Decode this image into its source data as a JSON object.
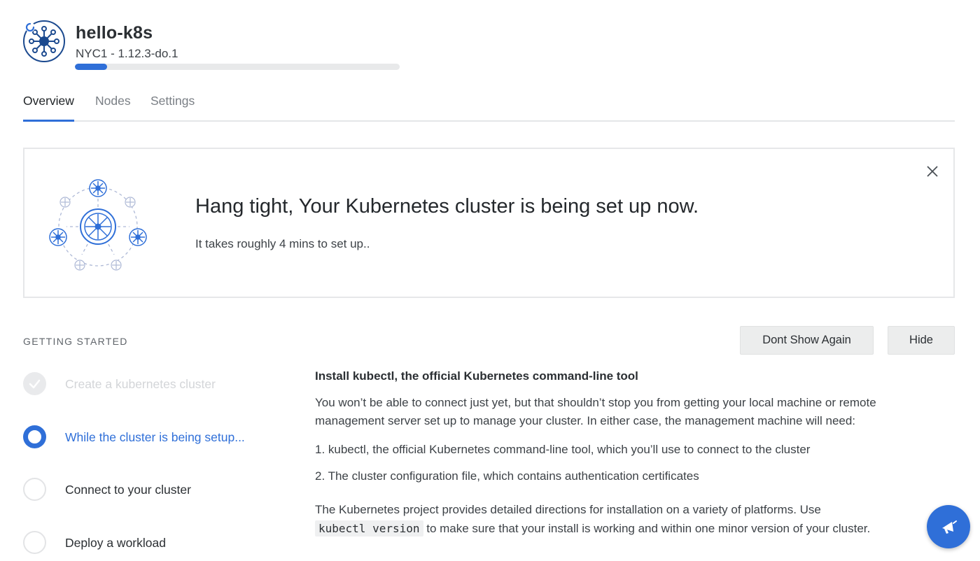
{
  "header": {
    "cluster_name": "hello-k8s",
    "cluster_meta": "NYC1 - 1.12.3-do.1",
    "provision_progress": 0.1,
    "logo_icon": "kubernetes-helm-icon",
    "spinner_icon": "loading-spinner-icon"
  },
  "tabs": [
    {
      "label": "Overview",
      "active": true
    },
    {
      "label": "Nodes",
      "active": false
    },
    {
      "label": "Settings",
      "active": false
    }
  ],
  "banner": {
    "title": "Hang tight, Your Kubernetes cluster is being set up now.",
    "subtitle": "It takes roughly 4 mins to set up..",
    "close_icon": "close-icon",
    "illustration": "kubernetes-cluster-illustration"
  },
  "getting_started": {
    "heading": "GETTING STARTED",
    "dont_show_again_label": "Dont Show Again",
    "hide_label": "Hide",
    "steps": [
      {
        "label": "Create a kubernetes cluster",
        "state": "done"
      },
      {
        "label": "While the cluster is being setup...",
        "state": "active"
      },
      {
        "label": "Connect to your cluster",
        "state": "pending"
      },
      {
        "label": "Deploy a workload",
        "state": "pending"
      }
    ]
  },
  "content": {
    "title": "Install kubectl, the official Kubernetes command-line tool",
    "paragraph1": "You won’t be able to connect just yet, but that shouldn’t stop you from getting your local machine or remote management server set up to manage your cluster. In either case, the management machine will need:",
    "list_item1": "1. kubectl, the official Kubernetes command-line tool, which you’ll use to connect to the cluster",
    "list_item2": "2. The cluster configuration file, which contains authentication certificates",
    "paragraph2_before": "The Kubernetes project provides detailed directions for installation on a variety of platforms. Use",
    "paragraph2_code": "kubectl version",
    "paragraph2_after": "to make sure that your install is working and within one minor version of your cluster."
  },
  "fab": {
    "icon": "megaphone-icon"
  },
  "colors": {
    "accent": "#2f6fd8",
    "logo_navy": "#1c4a8f"
  }
}
